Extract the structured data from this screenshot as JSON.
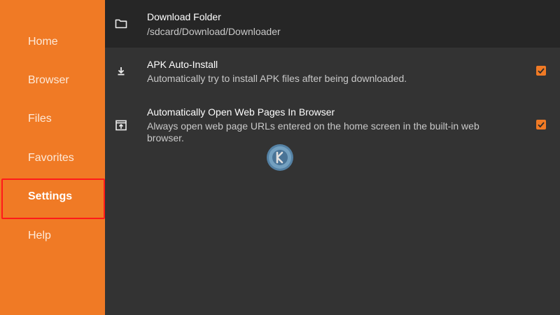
{
  "sidebar": {
    "items": [
      {
        "label": "Home"
      },
      {
        "label": "Browser"
      },
      {
        "label": "Files"
      },
      {
        "label": "Favorites"
      },
      {
        "label": "Settings",
        "active": true
      },
      {
        "label": "Help"
      }
    ]
  },
  "settings": {
    "download_folder": {
      "title": "Download Folder",
      "value": "/sdcard/Download/Downloader",
      "icon": "folder-icon"
    },
    "apk_auto_install": {
      "title": "APK Auto-Install",
      "description": "Automatically try to install APK files after being downloaded.",
      "checked": true,
      "icon": "download-icon"
    },
    "auto_open_web": {
      "title": "Automatically Open Web Pages In Browser",
      "description": "Always open web page URLs entered on the home screen in the built-in web browser.",
      "checked": true,
      "icon": "open-in-browser-icon"
    }
  },
  "colors": {
    "accent": "#f07a25",
    "background": "#333333",
    "selected_row": "#262626",
    "highlight_border": "#ff1a1a"
  }
}
